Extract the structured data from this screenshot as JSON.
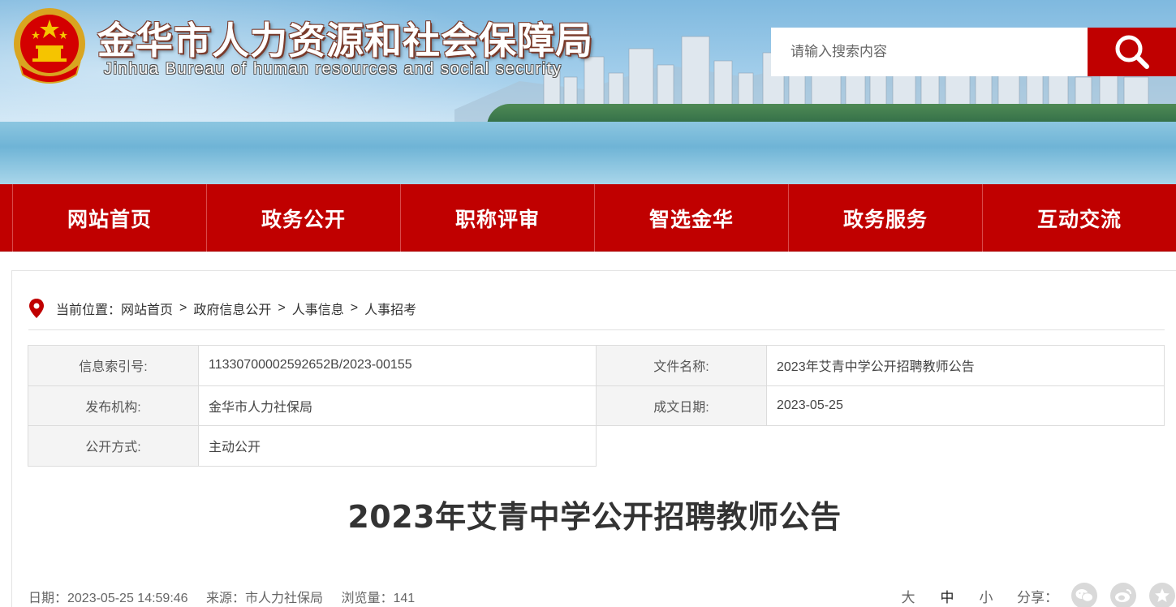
{
  "header": {
    "title": "金华市人力资源和社会保障局",
    "subtitle": "Jinhua Bureau of human resources and social security",
    "search_placeholder": "请输入搜索内容",
    "brand_color": "#c00000"
  },
  "nav": {
    "items": [
      {
        "label": "网站首页"
      },
      {
        "label": "政务公开"
      },
      {
        "label": "职称评审"
      },
      {
        "label": "智选金华"
      },
      {
        "label": "政务服务"
      },
      {
        "label": "互动交流"
      }
    ]
  },
  "breadcrumb": {
    "prefix": "当前位置：",
    "items": [
      "网站首页",
      "政府信息公开",
      "人事信息",
      "人事招考"
    ],
    "separator": ">"
  },
  "meta": {
    "index_label": "信息索引号:",
    "index_value": "11330700002592652B/2023-00155",
    "filename_label": "文件名称:",
    "filename_value": "2023年艾青中学公开招聘教师公告",
    "publisher_label": "发布机构:",
    "publisher_value": "金华市人力社保局",
    "date_label": "成文日期:",
    "date_value": "2023-05-25",
    "method_label": "公开方式:",
    "method_value": "主动公开"
  },
  "article": {
    "title": "2023年艾青中学公开招聘教师公告",
    "date": "日期：2023-05-25 14:59:46",
    "source": "来源：市人力社保局",
    "views": "浏览量：141"
  },
  "tools": {
    "font_large": "大",
    "font_medium": "中",
    "font_small": "小",
    "share_label": "分享："
  }
}
